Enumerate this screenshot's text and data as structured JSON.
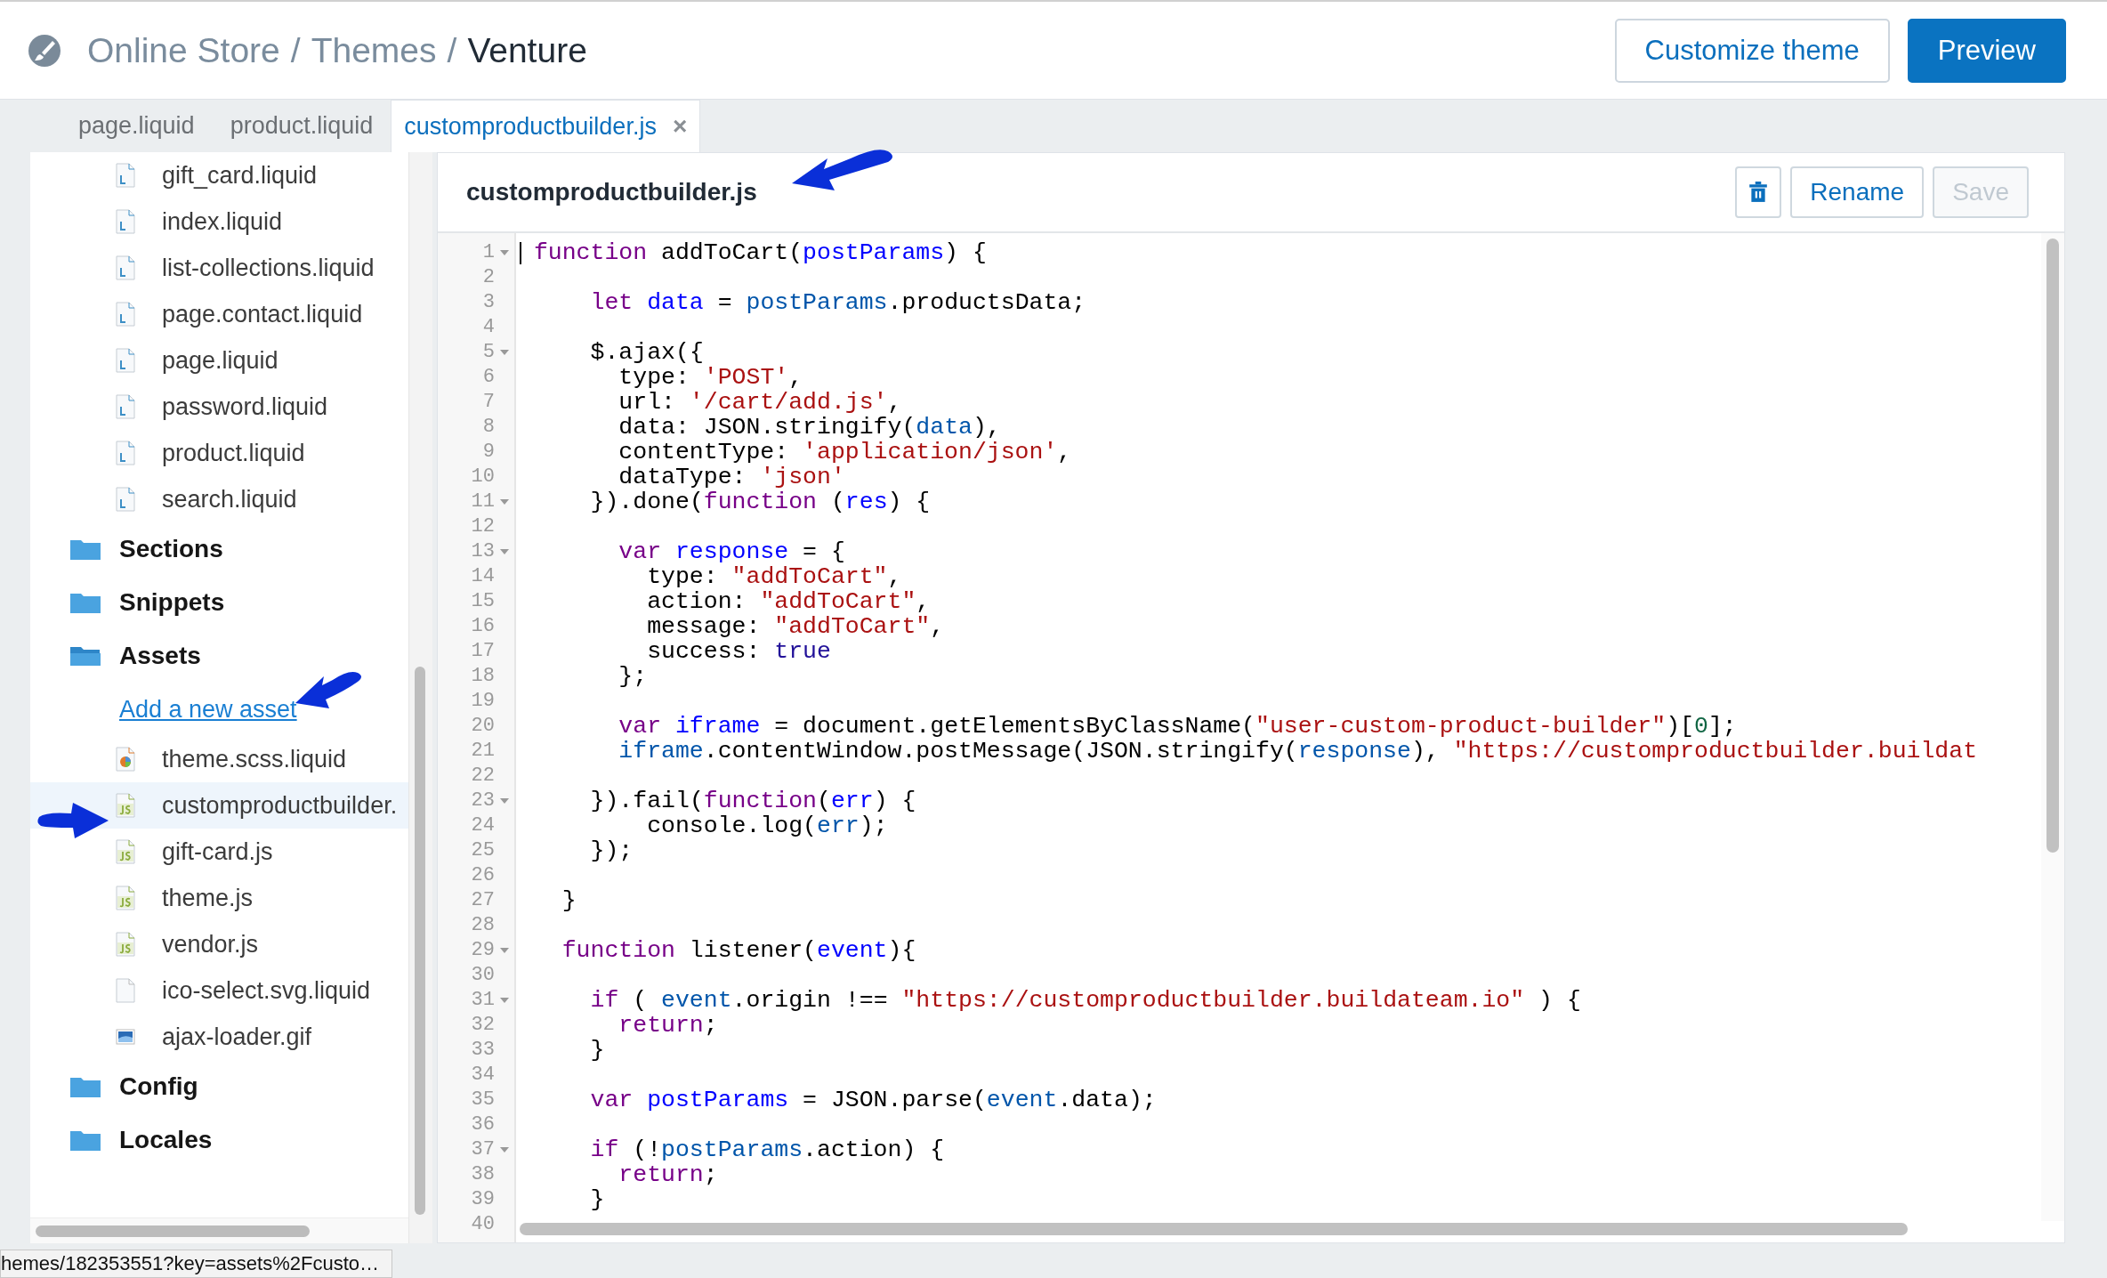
{
  "breadcrumb": {
    "parents": [
      "Online Store",
      "Themes"
    ],
    "separator": "/",
    "current": "Venture"
  },
  "header_buttons": [
    {
      "label": "Customize theme",
      "kind": "secondary"
    },
    {
      "label": "Preview",
      "kind": "primary"
    }
  ],
  "editor_tabs": [
    {
      "label": "page.liquid",
      "selected": false
    },
    {
      "label": "product.liquid",
      "selected": false
    },
    {
      "label": "customproductbuilder.js",
      "selected": true,
      "close": "×"
    }
  ],
  "sidebar": {
    "scrolled_folder_files": [
      {
        "name": "gift_card.liquid",
        "kind": "liquid"
      },
      {
        "name": "index.liquid",
        "kind": "liquid"
      },
      {
        "name": "list-collections.liquid",
        "kind": "liquid"
      },
      {
        "name": "page.contact.liquid",
        "kind": "liquid"
      },
      {
        "name": "page.liquid",
        "kind": "liquid"
      },
      {
        "name": "password.liquid",
        "kind": "liquid"
      },
      {
        "name": "product.liquid",
        "kind": "liquid"
      },
      {
        "name": "search.liquid",
        "kind": "liquid"
      }
    ],
    "folders": [
      {
        "name": "Sections",
        "expanded": false
      },
      {
        "name": "Snippets",
        "expanded": false
      },
      {
        "name": "Assets",
        "expanded": true,
        "add_link": "Add a new asset",
        "children": [
          {
            "name": "theme.scss.liquid",
            "kind": "scss",
            "selected": false
          },
          {
            "name": "customproductbuilder.",
            "kind": "js",
            "selected": true
          },
          {
            "name": "gift-card.js",
            "kind": "js",
            "selected": false
          },
          {
            "name": "theme.js",
            "kind": "js",
            "selected": false
          },
          {
            "name": "vendor.js",
            "kind": "js",
            "selected": false
          },
          {
            "name": "ico-select.svg.liquid",
            "kind": "blank",
            "selected": false
          },
          {
            "name": "ajax-loader.gif",
            "kind": "image",
            "selected": false
          }
        ]
      },
      {
        "name": "Config",
        "expanded": false
      },
      {
        "name": "Locales",
        "expanded": false
      }
    ]
  },
  "editor": {
    "file_name": "customproductbuilder.js",
    "buttons": [
      {
        "kind": "delete"
      },
      {
        "kind": "text",
        "label": "Rename",
        "disabled": false
      },
      {
        "kind": "text",
        "label": "Save",
        "disabled": true
      }
    ],
    "lines": [
      {
        "n": "1",
        "fold": true,
        "code": "function addToCart(postParams) {"
      },
      {
        "n": "2",
        "fold": false
      },
      {
        "n": "3",
        "fold": false,
        "code": "    let data = postParams.productsData;"
      },
      {
        "n": "4",
        "fold": false
      },
      {
        "n": "5",
        "fold": true,
        "code": "    $.ajax({"
      },
      {
        "n": "6",
        "fold": false,
        "code": "      type: 'POST',"
      },
      {
        "n": "7",
        "fold": false,
        "code": "      url: '/cart/add.js',"
      },
      {
        "n": "8",
        "fold": false,
        "code": "      data: JSON.stringify(data),"
      },
      {
        "n": "9",
        "fold": false,
        "code": "      contentType: 'application/json',"
      },
      {
        "n": "10",
        "fold": false,
        "code": "      dataType: 'json'"
      },
      {
        "n": "11",
        "fold": true,
        "code": "    }).done(function (res) {"
      },
      {
        "n": "12",
        "fold": false
      },
      {
        "n": "13",
        "fold": true,
        "code": "      var response = {"
      },
      {
        "n": "14",
        "fold": false,
        "code": "        type: \"addToCart\","
      },
      {
        "n": "15",
        "fold": false,
        "code": "        action: \"addToCart\","
      },
      {
        "n": "16",
        "fold": false,
        "code": "        message: \"addToCart\","
      },
      {
        "n": "17",
        "fold": false,
        "code": "        success: true"
      },
      {
        "n": "18",
        "fold": false,
        "code": "      };"
      },
      {
        "n": "19",
        "fold": false
      },
      {
        "n": "20",
        "fold": false,
        "code": "      var iframe = document.getElementsByClassName(\"user-custom-product-builder\")[0];"
      },
      {
        "n": "21",
        "fold": false,
        "code": "      iframe.contentWindow.postMessage(JSON.stringify(response), \"https://customproductbuilder.buildat"
      },
      {
        "n": "22",
        "fold": false
      },
      {
        "n": "23",
        "fold": true,
        "code": "    }).fail(function(err) {"
      },
      {
        "n": "24",
        "fold": false,
        "code": "        console.log(err);"
      },
      {
        "n": "25",
        "fold": false,
        "code": "    });"
      },
      {
        "n": "26",
        "fold": false
      },
      {
        "n": "27",
        "fold": false,
        "code": "  }"
      },
      {
        "n": "28",
        "fold": false
      },
      {
        "n": "29",
        "fold": true,
        "code": "  function listener(event){"
      },
      {
        "n": "30",
        "fold": false
      },
      {
        "n": "31",
        "fold": true,
        "code": "    if ( event.origin !== \"https://customproductbuilder.buildateam.io\" ) {"
      },
      {
        "n": "32",
        "fold": false,
        "code": "      return;"
      },
      {
        "n": "33",
        "fold": false,
        "code": "    }"
      },
      {
        "n": "34",
        "fold": false
      },
      {
        "n": "35",
        "fold": false,
        "code": "    var postParams = JSON.parse(event.data);"
      },
      {
        "n": "36",
        "fold": false
      },
      {
        "n": "37",
        "fold": true,
        "code": "    if (!postParams.action) {"
      },
      {
        "n": "38",
        "fold": false,
        "code": "      return;"
      },
      {
        "n": "39",
        "fold": false,
        "code": "    }"
      },
      {
        "n": "40",
        "fold": false
      }
    ]
  },
  "status_url": "hemes/182353551?key=assets%2Fcusto…"
}
